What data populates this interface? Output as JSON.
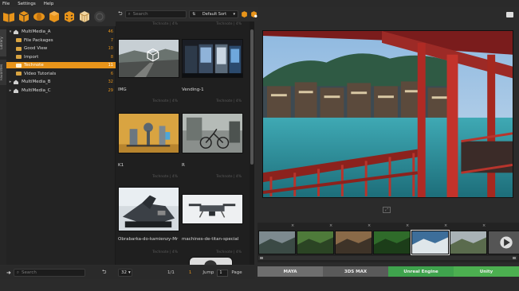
{
  "menu": [
    "File",
    "Settings",
    "Help"
  ],
  "toolbar": {
    "icons": [
      "book-icon",
      "package-icon",
      "sphere-icon",
      "box-icon",
      "checker-box-icon",
      "grid-box-icon",
      "disabled-icon"
    ]
  },
  "sidetabs": [
    "Library",
    "Favorites"
  ],
  "tree": [
    {
      "label": "MultiMedia_A",
      "count": "46",
      "level": 0,
      "type": "home",
      "expanded": true
    },
    {
      "label": "File Packages",
      "count": "7",
      "level": 1,
      "type": "folder"
    },
    {
      "label": "Good View",
      "count": "10",
      "level": 1,
      "type": "folder"
    },
    {
      "label": "Import",
      "count": "8",
      "level": 1,
      "type": "folder"
    },
    {
      "label": "Technote",
      "count": "11",
      "level": 1,
      "type": "folder",
      "selected": true
    },
    {
      "label": "Video Tutorials",
      "count": "6",
      "level": 1,
      "type": "folder"
    },
    {
      "label": "MultiMedia_B",
      "count": "32",
      "level": 0,
      "type": "home"
    },
    {
      "label": "MultiMedia_C",
      "count": "29",
      "level": 0,
      "type": "home"
    }
  ],
  "left_search": {
    "placeholder": "Search"
  },
  "mid_search": {
    "placeholder": "Search"
  },
  "sort": {
    "value": "Default Sort"
  },
  "assets": [
    {
      "name": "IMG",
      "meta": "Technote | 4%"
    },
    {
      "name": "Vending-1",
      "meta": "Technote | 4%"
    },
    {
      "name": "K1",
      "meta": "Technote | 4%"
    },
    {
      "name": "R",
      "meta": "Technote | 4%"
    },
    {
      "name": "Obrabarka-do-kamienzy-Mr",
      "meta": "Technote | 4%"
    },
    {
      "name": "machines-de-titan-special",
      "meta": "Technote | 4%"
    }
  ],
  "pager": {
    "per_page": "32",
    "page_info": "1/1",
    "current": "1",
    "jump_label": "Jump",
    "jump_value": "1",
    "page_label": "Page"
  },
  "renderers": [
    {
      "label": "MAYA",
      "color": "#6e6e6e"
    },
    {
      "label": "3DS MAX",
      "color": "#5a5a5a"
    },
    {
      "label": "Unreal Engine",
      "color": "#3fa34d"
    },
    {
      "label": "Unity",
      "color": "#4caf50"
    }
  ],
  "strip_count": 7
}
